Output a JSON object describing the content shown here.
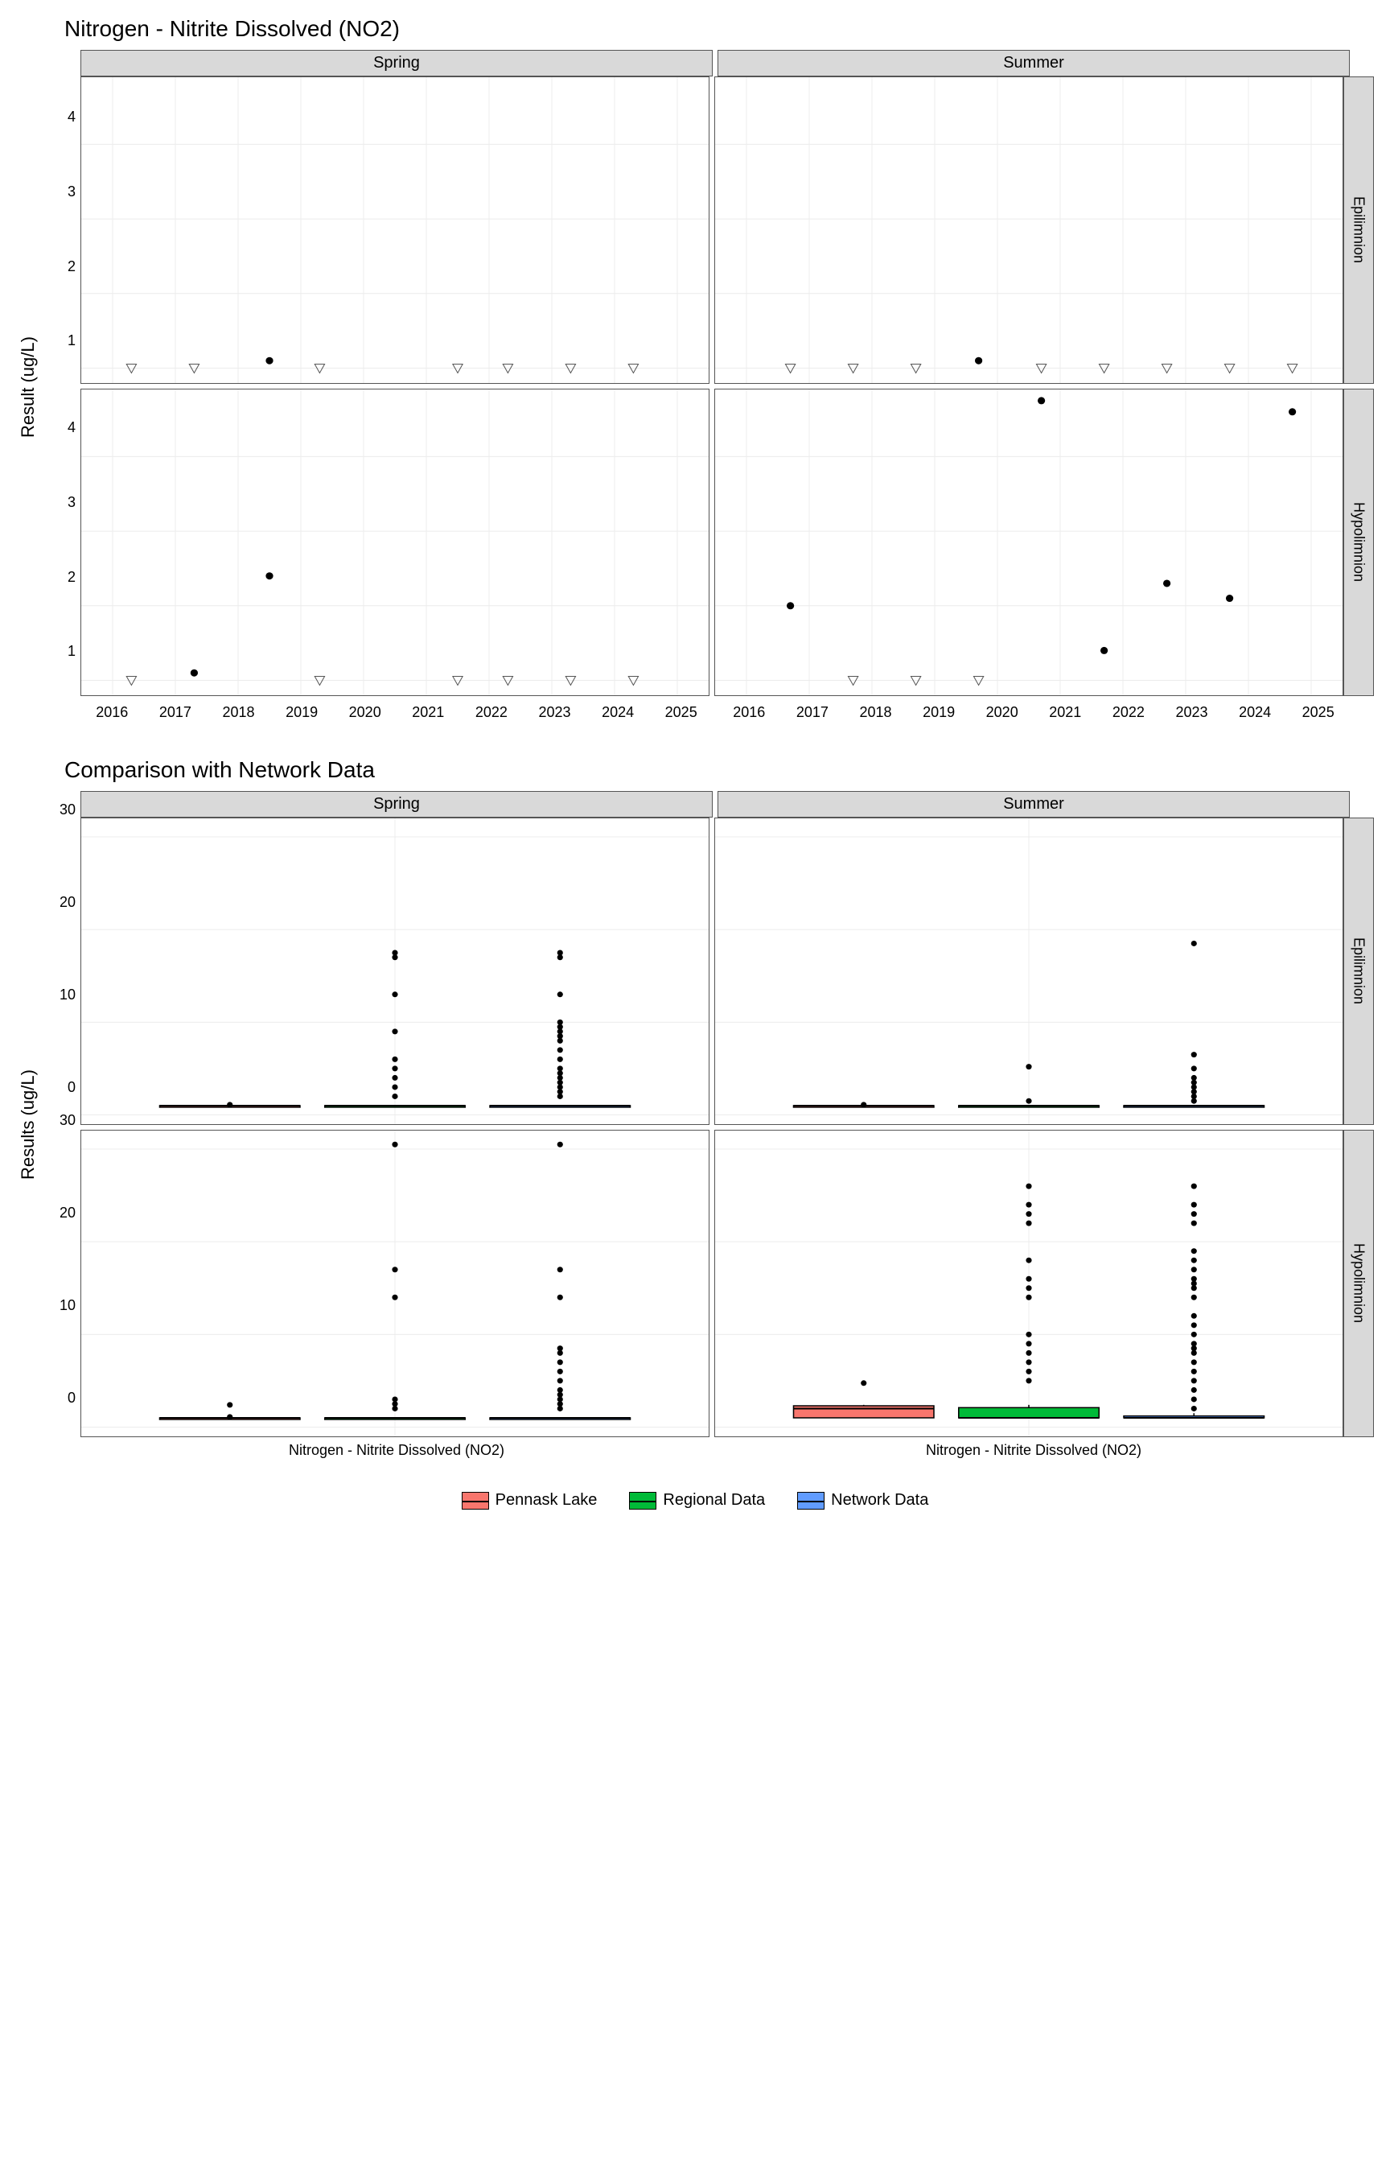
{
  "chart_data": [
    {
      "type": "scatter",
      "title": "Nitrogen - Nitrite Dissolved (NO2)",
      "ylabel": "Result (ug/L)",
      "ylim": [
        0.8,
        4.9
      ],
      "yticks": [
        1,
        2,
        3,
        4
      ],
      "x": [
        2016,
        2017,
        2018,
        2019,
        2020,
        2021,
        2022,
        2023,
        2024,
        2025
      ],
      "facets": {
        "cols": [
          "Spring",
          "Summer"
        ],
        "rows": [
          "Epilimnion",
          "Hypolimnion"
        ]
      },
      "panels": {
        "Spring_Epilimnion": {
          "points": [
            {
              "x": 2018.5,
              "y": 1.1,
              "type": "dot"
            }
          ],
          "censored": [
            {
              "x": 2016.3,
              "y": 1.0
            },
            {
              "x": 2017.3,
              "y": 1.0
            },
            {
              "x": 2019.3,
              "y": 1.0
            },
            {
              "x": 2021.5,
              "y": 1.0
            },
            {
              "x": 2022.3,
              "y": 1.0
            },
            {
              "x": 2023.3,
              "y": 1.0
            },
            {
              "x": 2024.3,
              "y": 1.0
            }
          ]
        },
        "Summer_Epilimnion": {
          "points": [
            {
              "x": 2019.7,
              "y": 1.1,
              "type": "dot"
            }
          ],
          "censored": [
            {
              "x": 2016.7,
              "y": 1.0
            },
            {
              "x": 2017.7,
              "y": 1.0
            },
            {
              "x": 2018.7,
              "y": 1.0
            },
            {
              "x": 2020.7,
              "y": 1.0
            },
            {
              "x": 2021.7,
              "y": 1.0
            },
            {
              "x": 2022.7,
              "y": 1.0
            },
            {
              "x": 2023.7,
              "y": 1.0
            },
            {
              "x": 2024.7,
              "y": 1.0
            }
          ]
        },
        "Spring_Hypolimnion": {
          "points": [
            {
              "x": 2017.3,
              "y": 1.1,
              "type": "dot"
            },
            {
              "x": 2018.5,
              "y": 2.4,
              "type": "dot"
            }
          ],
          "censored": [
            {
              "x": 2016.3,
              "y": 1.0
            },
            {
              "x": 2019.3,
              "y": 1.0
            },
            {
              "x": 2021.5,
              "y": 1.0
            },
            {
              "x": 2022.3,
              "y": 1.0
            },
            {
              "x": 2023.3,
              "y": 1.0
            },
            {
              "x": 2024.3,
              "y": 1.0
            }
          ]
        },
        "Summer_Hypolimnion": {
          "points": [
            {
              "x": 2016.7,
              "y": 2.0,
              "type": "dot"
            },
            {
              "x": 2020.7,
              "y": 4.75,
              "type": "dot"
            },
            {
              "x": 2021.7,
              "y": 1.4,
              "type": "dot"
            },
            {
              "x": 2022.7,
              "y": 2.3,
              "type": "dot"
            },
            {
              "x": 2023.7,
              "y": 2.1,
              "type": "dot"
            },
            {
              "x": 2024.7,
              "y": 4.6,
              "type": "dot"
            }
          ],
          "censored": [
            {
              "x": 2017.7,
              "y": 1.0
            },
            {
              "x": 2018.7,
              "y": 1.0
            },
            {
              "x": 2019.7,
              "y": 1.0
            }
          ]
        }
      }
    },
    {
      "type": "box",
      "title": "Comparison with Network Data",
      "ylabel": "Results (ug/L)",
      "xlabel": "Nitrogen - Nitrite Dissolved (NO2)",
      "ylim": [
        -1,
        32
      ],
      "yticks": [
        0,
        10,
        20,
        30
      ],
      "facets": {
        "cols": [
          "Spring",
          "Summer"
        ],
        "rows": [
          "Epilimnion",
          "Hypolimnion"
        ]
      },
      "series": [
        {
          "name": "Pennask Lake",
          "color": "#F8766D"
        },
        {
          "name": "Regional Data",
          "color": "#00BA38"
        },
        {
          "name": "Network Data",
          "color": "#619CFF"
        }
      ],
      "panels": {
        "Spring_Epilimnion": {
          "boxes": [
            {
              "series": 0,
              "q1": 1.0,
              "med": 1.0,
              "q3": 1.0,
              "lw": 1.0,
              "uw": 1.1,
              "outliers": [
                1.1
              ]
            },
            {
              "series": 1,
              "q1": 1.0,
              "med": 1.0,
              "q3": 1.0,
              "lw": 1.0,
              "uw": 1.0,
              "outliers": [
                2,
                3,
                4,
                5,
                6,
                9,
                13,
                17,
                17.5
              ]
            },
            {
              "series": 2,
              "q1": 1.0,
              "med": 1.0,
              "q3": 1.0,
              "lw": 1.0,
              "uw": 1.0,
              "outliers": [
                2,
                2.5,
                3,
                3.5,
                4,
                4.5,
                5,
                6,
                7,
                8,
                8.5,
                9,
                9.5,
                10,
                13,
                17,
                17.5
              ]
            }
          ]
        },
        "Summer_Epilimnion": {
          "boxes": [
            {
              "series": 0,
              "q1": 1.0,
              "med": 1.0,
              "q3": 1.0,
              "lw": 1.0,
              "uw": 1.1,
              "outliers": [
                1.1
              ]
            },
            {
              "series": 1,
              "q1": 1.0,
              "med": 1.0,
              "q3": 1.0,
              "lw": 1.0,
              "uw": 1.0,
              "outliers": [
                1.5,
                5.2
              ]
            },
            {
              "series": 2,
              "q1": 1.0,
              "med": 1.0,
              "q3": 1.0,
              "lw": 1.0,
              "uw": 1.0,
              "outliers": [
                1.5,
                2,
                2.5,
                3,
                3.5,
                4,
                5,
                6.5,
                18.5
              ]
            }
          ]
        },
        "Spring_Hypolimnion": {
          "boxes": [
            {
              "series": 0,
              "q1": 1.0,
              "med": 1.0,
              "q3": 1.0,
              "lw": 1.0,
              "uw": 1.1,
              "outliers": [
                1.1,
                2.4
              ]
            },
            {
              "series": 1,
              "q1": 1.0,
              "med": 1.0,
              "q3": 1.0,
              "lw": 1.0,
              "uw": 1.0,
              "outliers": [
                2,
                2.5,
                3,
                14,
                17,
                30.5
              ]
            },
            {
              "series": 2,
              "q1": 1.0,
              "med": 1.0,
              "q3": 1.0,
              "lw": 1.0,
              "uw": 1.0,
              "outliers": [
                2,
                2.5,
                3,
                3.5,
                4,
                5,
                6,
                7,
                8,
                8.5,
                14,
                17,
                30.5
              ]
            }
          ]
        },
        "Summer_Hypolimnion": {
          "boxes": [
            {
              "series": 0,
              "q1": 1.0,
              "med": 2.0,
              "q3": 2.3,
              "lw": 1.0,
              "uw": 2.4,
              "outliers": [
                4.75
              ]
            },
            {
              "series": 1,
              "q1": 1.0,
              "med": 1.0,
              "q3": 2.1,
              "lw": 1.0,
              "uw": 2.4,
              "outliers": [
                5,
                6,
                7,
                8,
                9,
                10,
                14,
                15,
                16,
                18,
                22,
                23,
                24,
                26
              ]
            },
            {
              "series": 2,
              "q1": 1.0,
              "med": 1.0,
              "q3": 1.2,
              "lw": 1.0,
              "uw": 1.5,
              "outliers": [
                2,
                3,
                4,
                5,
                6,
                7,
                8,
                8.5,
                9,
                10,
                11,
                12,
                14,
                15,
                15.5,
                16,
                17,
                18,
                19,
                22,
                23,
                24,
                26
              ]
            }
          ]
        }
      }
    }
  ],
  "legend": {
    "items": [
      "Pennask Lake",
      "Regional Data",
      "Network Data"
    ],
    "colors": [
      "#F8766D",
      "#00BA38",
      "#619CFF"
    ]
  }
}
